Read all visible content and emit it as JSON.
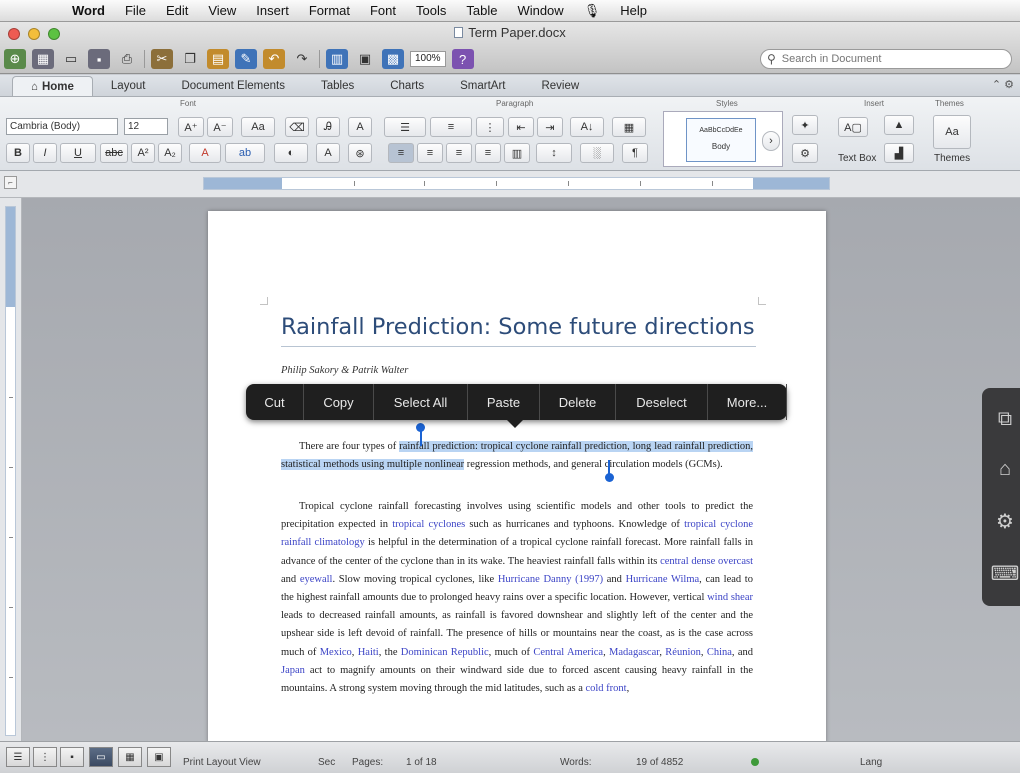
{
  "menubar": {
    "apple": "",
    "app_name": "Word",
    "items": [
      "File",
      "Edit",
      "View",
      "Insert",
      "Format",
      "Font",
      "Tools",
      "Table",
      "Window",
      "Help"
    ],
    "script_glyph": "🎙"
  },
  "window": {
    "title": "Term Paper.docx",
    "zoom": "100%",
    "search_placeholder": "Search in Document"
  },
  "ribbon": {
    "tabs": [
      "Home",
      "Layout",
      "Document Elements",
      "Tables",
      "Charts",
      "SmartArt",
      "Review"
    ],
    "groups": [
      "Font",
      "Paragraph",
      "Styles",
      "Insert",
      "Themes"
    ],
    "font_name": "Cambria (Body)",
    "font_size": "12",
    "style_sample": "AaBbCcDdEe",
    "style_name": "Body",
    "text_box_label": "Text Box",
    "themes_label": "Themes"
  },
  "document": {
    "heading": "Rainfall Prediction: Some future directions",
    "authors": "Philip Sakory & Patrik Walter",
    "p1_before": "There are four types of ",
    "p1_selected": "rainfall prediction: tropical cyclone rainfall prediction, long lead rainfall prediction, statistical methods using multiple nonlinear",
    "p1_after": " regression methods, and general circulation models (GCMs).",
    "p2": [
      {
        "t": "Tropical cyclone rainfall forecasting involves using scientific models and other tools to predict the precipitation expected in "
      },
      {
        "t": "tropical cyclones",
        "link": true
      },
      {
        "t": " such as hurricanes and typhoons. Knowledge of "
      },
      {
        "t": "tropical cyclone rainfall climatology",
        "link": true
      },
      {
        "t": " is helpful in the determination of a tropical cyclone rainfall forecast. More rainfall falls in advance of the center of the cyclone than in its wake. The heaviest rainfall falls within its "
      },
      {
        "t": "central dense overcast",
        "link": true
      },
      {
        "t": " and "
      },
      {
        "t": "eyewall",
        "link": true
      },
      {
        "t": ". Slow moving tropical cyclones, like "
      },
      {
        "t": "Hurricane Danny (1997)",
        "link": true
      },
      {
        "t": " and "
      },
      {
        "t": "Hurricane Wilma",
        "link": true
      },
      {
        "t": ", can lead to the highest rainfall amounts due to prolonged heavy rains over a specific location. However, vertical "
      },
      {
        "t": "wind shear",
        "link": true
      },
      {
        "t": " leads to decreased rainfall amounts, as rainfall is favored downshear and slightly left of the center and the upshear side is left devoid of rainfall. The presence of hills or mountains near the coast, as is the case across much of "
      },
      {
        "t": "Mexico",
        "link": true
      },
      {
        "t": ", "
      },
      {
        "t": "Haiti",
        "link": true
      },
      {
        "t": ", the "
      },
      {
        "t": "Dominican Republic",
        "link": true
      },
      {
        "t": ", much of "
      },
      {
        "t": "Central America",
        "link": true
      },
      {
        "t": ", "
      },
      {
        "t": "Madagascar",
        "link": true
      },
      {
        "t": ", "
      },
      {
        "t": "Réunion",
        "link": true
      },
      {
        "t": ", "
      },
      {
        "t": "China",
        "link": true
      },
      {
        "t": ", and "
      },
      {
        "t": "Japan",
        "link": true
      },
      {
        "t": " act to magnify amounts on their windward side due to forced ascent causing heavy rainfall in the mountains. A strong system moving through the mid latitudes, such as a "
      },
      {
        "t": "cold front",
        "link": true
      },
      {
        "t": ","
      }
    ]
  },
  "context_menu": {
    "items": [
      "Cut",
      "Copy",
      "Select All",
      "Paste",
      "Delete",
      "Deselect",
      "More..."
    ]
  },
  "statusbar": {
    "view_label": "Print Layout View",
    "sec": "Sec",
    "pages_label": "Pages:",
    "pages_value": "1 of 18",
    "words_label": "Words:",
    "words_value": "19 of 4852",
    "lang": "Lang"
  }
}
